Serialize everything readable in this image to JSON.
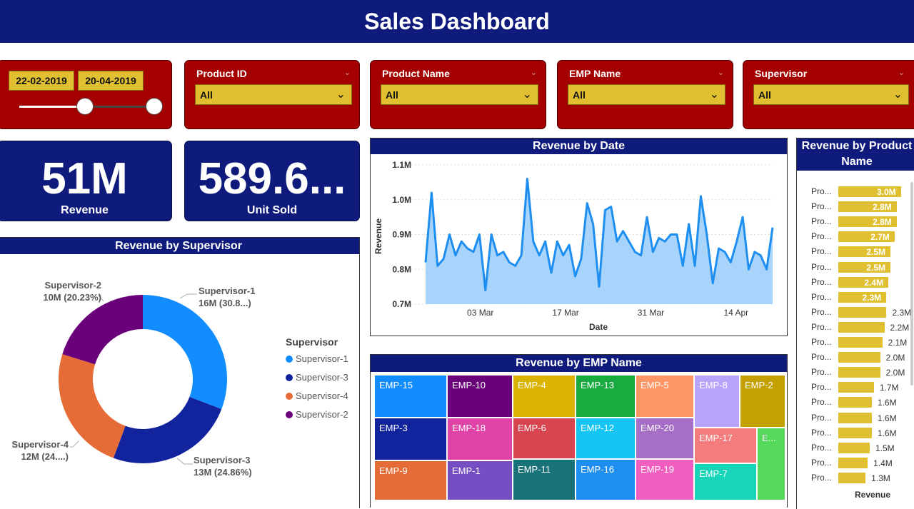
{
  "header": {
    "title": "Sales Dashboard"
  },
  "date_filter": {
    "start": "22-02-2019",
    "end": "20-04-2019",
    "slider_start_fraction": 0.0,
    "slider_end_fraction": 1.0
  },
  "filters": [
    {
      "label": "Product ID",
      "value": "All"
    },
    {
      "label": "Product Name",
      "value": "All"
    },
    {
      "label": "EMP Name",
      "value": "All"
    },
    {
      "label": "Supervisor",
      "value": "All"
    }
  ],
  "kpis": [
    {
      "value": "51M",
      "label": "Revenue"
    },
    {
      "value": "589.6...",
      "label": "Unit Sold"
    }
  ],
  "supervisor_chart": {
    "title": "Revenue by Supervisor",
    "legend_title": "Supervisor",
    "legend": [
      "Supervisor-1",
      "Supervisor-3",
      "Supervisor-4",
      "Supervisor-2"
    ],
    "labels": [
      {
        "name": "Supervisor-1",
        "value": "16M (30.8...)"
      },
      {
        "name": "Supervisor-3",
        "value": "13M (24.86%)"
      },
      {
        "name": "Supervisor-4",
        "value": "12M (24....)"
      },
      {
        "name": "Supervisor-2",
        "value": "10M (20.23%)"
      }
    ]
  },
  "date_chart": {
    "title": "Revenue by Date",
    "xlabel": "Date",
    "ylabel": "Revenue",
    "yticks": [
      "1.1M",
      "1.0M",
      "0.9M",
      "0.8M",
      "0.7M"
    ],
    "xticks": [
      "03 Mar",
      "17 Mar",
      "31 Mar",
      "14 Apr"
    ]
  },
  "emp_chart": {
    "title": "Revenue by EMP Name",
    "tiles": [
      "EMP-15",
      "EMP-10",
      "EMP-4",
      "EMP-13",
      "EMP-5",
      "EMP-8",
      "EMP-2",
      "EMP-3",
      "EMP-18",
      "EMP-6",
      "EMP-12",
      "EMP-20",
      "EMP-17",
      "E...",
      "EMP-9",
      "EMP-1",
      "EMP-11",
      "EMP-16",
      "EMP-19",
      "EMP-7"
    ]
  },
  "product_chart": {
    "title": "Revenue by Product Name",
    "xlabel": "Revenue",
    "row_label": "Pro...",
    "values": [
      "3.0M",
      "2.8M",
      "2.8M",
      "2.7M",
      "2.5M",
      "2.5M",
      "2.4M",
      "2.3M",
      "2.3M",
      "2.2M",
      "2.1M",
      "2.0M",
      "2.0M",
      "1.7M",
      "1.6M",
      "1.6M",
      "1.6M",
      "1.5M",
      "1.4M",
      "1.3M"
    ]
  },
  "chart_data": [
    {
      "type": "pie",
      "title": "Revenue by Supervisor",
      "categories": [
        "Supervisor-1",
        "Supervisor-3",
        "Supervisor-4",
        "Supervisor-2"
      ],
      "values": [
        30.8,
        24.86,
        24.11,
        20.23
      ],
      "colors": [
        "#118dff",
        "#12239e",
        "#e66c37",
        "#6b007b"
      ]
    },
    {
      "type": "area",
      "title": "Revenue by Date",
      "xlabel": "Date",
      "ylabel": "Revenue",
      "ylim": [
        0.7,
        1.1
      ],
      "x_start": "2019-02-22",
      "x_end": "2019-04-20",
      "values": [
        0.82,
        1.02,
        0.81,
        0.83,
        0.9,
        0.84,
        0.88,
        0.86,
        0.85,
        0.9,
        0.74,
        0.9,
        0.84,
        0.85,
        0.82,
        0.81,
        0.84,
        1.06,
        0.88,
        0.84,
        0.88,
        0.79,
        0.88,
        0.84,
        0.87,
        0.78,
        0.83,
        0.99,
        0.93,
        0.75,
        0.97,
        0.98,
        0.88,
        0.91,
        0.88,
        0.85,
        0.84,
        0.95,
        0.85,
        0.89,
        0.88,
        0.9,
        0.9,
        0.81,
        0.93,
        0.81,
        1.01,
        0.9,
        0.76,
        0.86,
        0.85,
        0.82,
        0.88,
        0.95,
        0.8,
        0.85,
        0.84,
        0.8,
        0.92
      ]
    },
    {
      "type": "bar",
      "title": "Revenue by Product Name",
      "xlabel": "Revenue",
      "values": [
        3.0,
        2.8,
        2.8,
        2.7,
        2.5,
        2.5,
        2.4,
        2.3,
        2.3,
        2.2,
        2.1,
        2.0,
        2.0,
        1.7,
        1.6,
        1.6,
        1.6,
        1.5,
        1.4,
        1.3
      ]
    }
  ]
}
